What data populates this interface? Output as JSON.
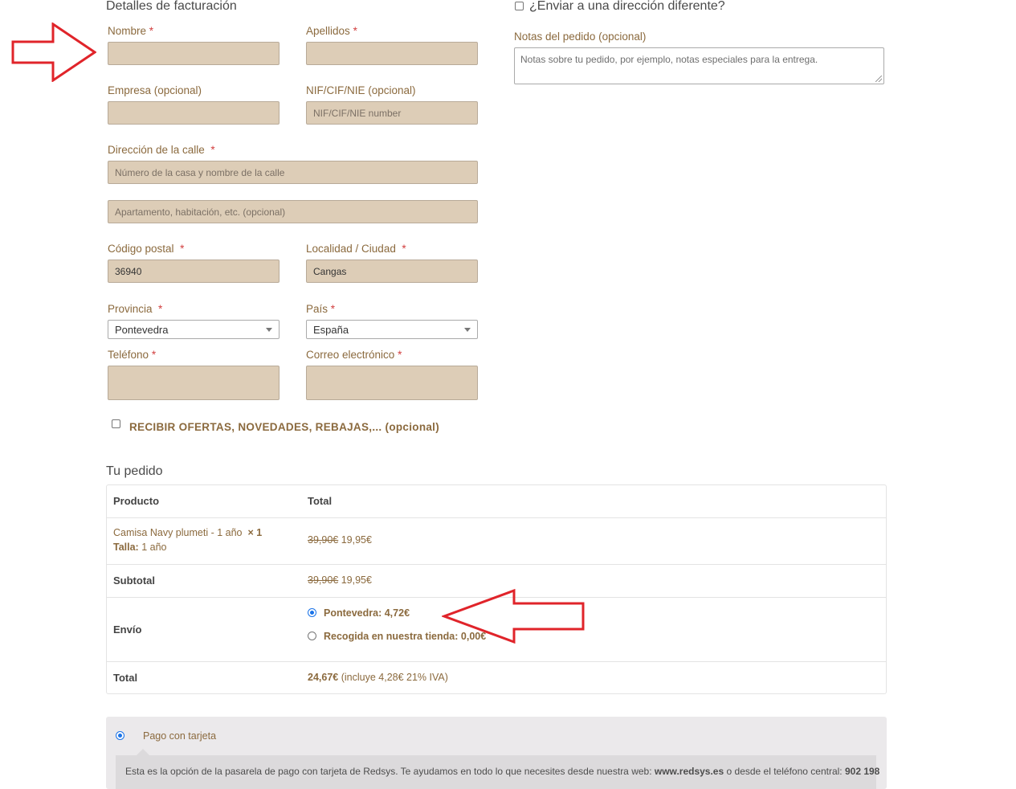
{
  "billing": {
    "title": "Detalles de facturación",
    "first_name": {
      "label": "Nombre",
      "req": "*",
      "value": ""
    },
    "last_name": {
      "label": "Apellidos",
      "req": "*",
      "value": ""
    },
    "company": {
      "label": "Empresa (opcional)",
      "value": ""
    },
    "nif": {
      "label": "NIF/CIF/NIE (opcional)",
      "placeholder": "NIF/CIF/NIE number"
    },
    "street": {
      "label": "Dirección de la calle",
      "req": "*",
      "placeholder": "Número de la casa y nombre de la calle"
    },
    "street2": {
      "placeholder": "Apartamento, habitación, etc. (opcional)"
    },
    "postcode": {
      "label": "Código postal",
      "req": "*",
      "value": "36940"
    },
    "city": {
      "label": "Localidad / Ciudad",
      "req": "*",
      "value": "Cangas"
    },
    "province": {
      "label": "Provincia",
      "req": "*",
      "value": "Pontevedra"
    },
    "country": {
      "label": "País",
      "req": "*",
      "value": "España"
    },
    "phone": {
      "label": "Teléfono",
      "req": "*",
      "value": ""
    },
    "email": {
      "label": "Correo electrónico",
      "req": "*",
      "value": ""
    },
    "newsletter": "RECIBIR OFERTAS, NOVEDADES, REBAJAS,... (opcional)"
  },
  "shipping": {
    "different_address": "¿Enviar a una dirección diferente?",
    "notes_label": "Notas del pedido (opcional)",
    "notes_placeholder": "Notas sobre tu pedido, por ejemplo, notas especiales para la entrega."
  },
  "order": {
    "title": "Tu pedido",
    "col_product": "Producto",
    "col_total": "Total",
    "item": {
      "name": "Camisa Navy plumeti - 1 año",
      "qty": "× 1",
      "size_label": "Talla:",
      "size_value": "1 año",
      "old_price": "39,90€",
      "price": "19,95€"
    },
    "subtotal": {
      "label": "Subtotal",
      "old": "39,90€",
      "price": "19,95€"
    },
    "shipping_label": "Envío",
    "shipping_options": [
      {
        "label": "Pontevedra:",
        "price": "4,72€",
        "selected": true
      },
      {
        "label": "Recogida en nuestra tienda:",
        "price": "0,00€",
        "selected": false
      }
    ],
    "total": {
      "label": "Total",
      "price": "24,67€",
      "tax_note": "(incluye 4,28€ 21% IVA)"
    }
  },
  "payment": {
    "method": "Pago con tarjeta",
    "description_pre": "Esta es la opción de la pasarela de pago con tarjeta de Redsys. Te ayudamos en todo lo que necesites desde nuestra web:",
    "web": "www.redsys.es",
    "description_mid": "o desde el teléfono central:",
    "phone": "902 198"
  },
  "colors": {
    "field_bg": "#ddcdb7",
    "label_brown": "#8b6a3e",
    "required_red": "#d23f3f",
    "arrow_red": "#e0242a"
  },
  "icons": [
    "arrow-right-annotation-icon",
    "arrow-left-annotation-icon",
    "chevron-down-icon"
  ]
}
